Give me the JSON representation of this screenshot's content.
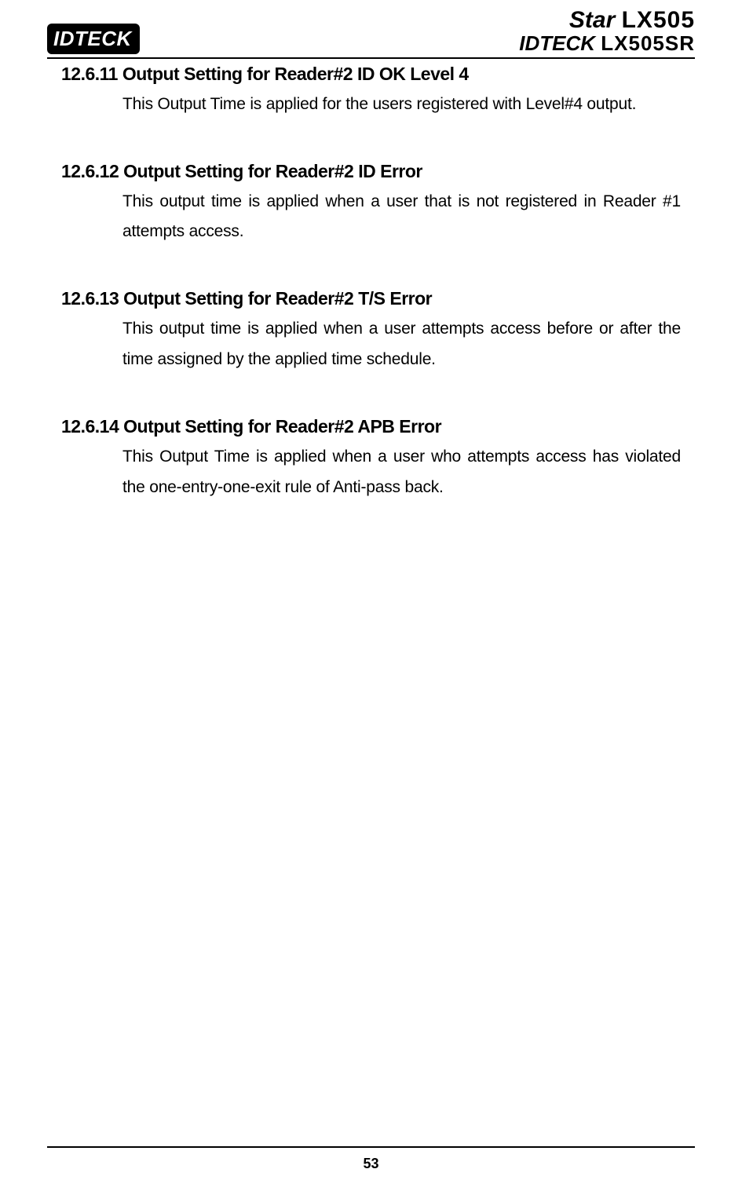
{
  "header": {
    "brand_left": "IDTECK",
    "brand_right_line1_brand": "Star",
    "brand_right_line1_model": "LX505",
    "brand_right_line2_brand": "IDTECK",
    "brand_right_line2_model": "LX505SR"
  },
  "sections": [
    {
      "heading": "12.6.11 Output Setting for Reader#2 ID OK Level 4",
      "body": "This Output Time is applied for the users registered with Level#4 output.",
      "justify": false
    },
    {
      "heading": "12.6.12 Output Setting for Reader#2 ID Error",
      "body": "This output time is applied when a user that is not registered in Reader #1 attempts access.",
      "justify": true
    },
    {
      "heading": "12.6.13 Output Setting for Reader#2 T/S Error",
      "body": "This output time is applied when a user attempts access before or after the time assigned by the applied time schedule.",
      "justify": true
    },
    {
      "heading": "12.6.14 Output Setting for Reader#2 APB Error",
      "body": "This Output Time is applied when a user who attempts access has violated the one-entry-one-exit rule of Anti-pass back.",
      "justify": true
    }
  ],
  "footer": {
    "page_number": "53"
  }
}
